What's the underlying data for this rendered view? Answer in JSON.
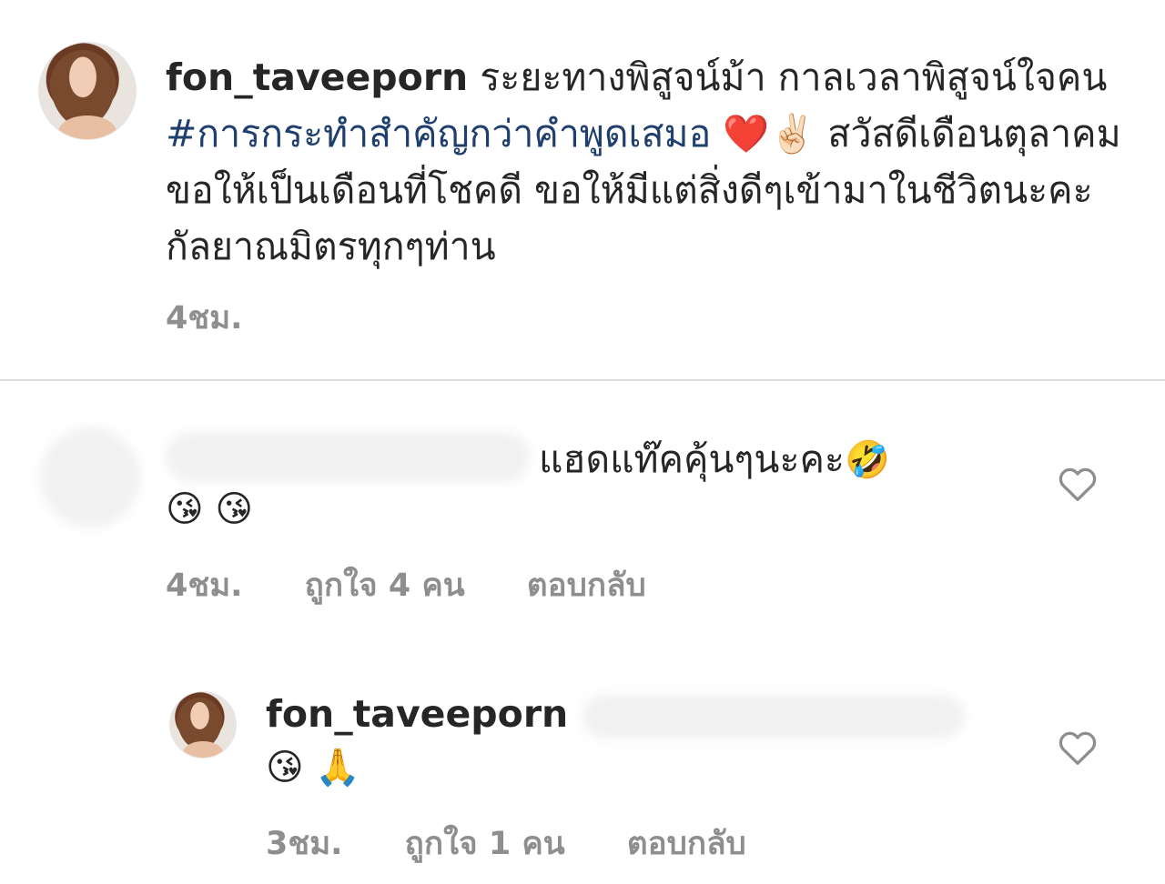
{
  "post": {
    "username": "fon_taveeporn",
    "caption_part1": "ระยะทางพิสูจน์ม้า กาลเวลาพิสูจน์ใจคน",
    "hashtag": "#การกระทำสำคัญกว่าคำพูดเสมอ",
    "emojis": "❤️✌🏻",
    "caption_part2": "สวัสดีเดือนตุลาคม ขอให้เป็นเดือนที่โชคดี ขอให้มีแต่สิ่งดีๆเข้ามาในชีวิตนะคะกัลยาณมิตรทุกๆท่าน",
    "time": "4ชม."
  },
  "comments": [
    {
      "text": "แฮดแท๊คคุ้นๆนะคะ",
      "emoji_inline": "🤣",
      "emoji_line": "😘 😘",
      "time": "4ชม.",
      "likes": "ถูกใจ 4 คน",
      "reply": "ตอบกลับ"
    },
    {
      "username": "fon_taveeporn",
      "emoji_line": "😘 🙏",
      "time": "3ชม.",
      "likes": "ถูกใจ 1 คน",
      "reply": "ตอบกลับ"
    }
  ],
  "icons": {
    "like": "heart-outline-icon"
  }
}
